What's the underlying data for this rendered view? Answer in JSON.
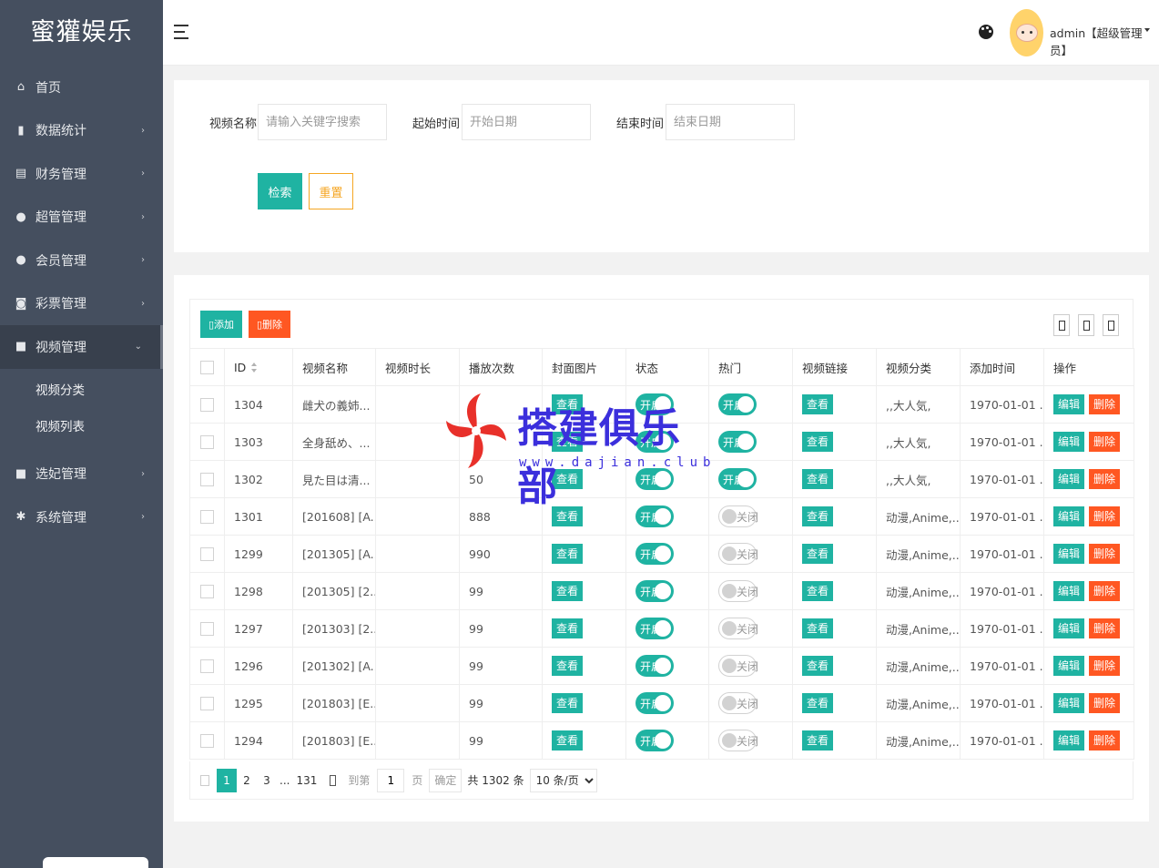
{
  "app": {
    "logo": "蜜獾娱乐"
  },
  "sidebar": {
    "items": [
      {
        "label": "首页",
        "icon": "home-icon",
        "has_arrow": false
      },
      {
        "label": "数据统计",
        "icon": "bar-chart-icon",
        "has_arrow": true
      },
      {
        "label": "财务管理",
        "icon": "bank-icon",
        "has_arrow": true
      },
      {
        "label": "超管管理",
        "icon": "user-icon",
        "has_arrow": true
      },
      {
        "label": "会员管理",
        "icon": "users-icon",
        "has_arrow": true
      },
      {
        "label": "彩票管理",
        "icon": "gamepad-icon",
        "has_arrow": true
      },
      {
        "label": "视频管理",
        "icon": "video-icon",
        "has_arrow": true,
        "active": true,
        "expanded": true
      },
      {
        "label": "选妃管理",
        "icon": "video-icon",
        "has_arrow": true
      },
      {
        "label": "系统管理",
        "icon": "gear-icon",
        "has_arrow": true
      }
    ],
    "sub_items": [
      "视频分类",
      "视频列表"
    ]
  },
  "header": {
    "user": "admin【超级管理员】"
  },
  "search": {
    "name_label": "视频名称",
    "name_placeholder": "请输入关键字搜索",
    "start_label": "起始时间",
    "start_placeholder": "开始日期",
    "end_label": "结束时间",
    "end_placeholder": "结束日期",
    "search_btn": "检索",
    "reset_btn": "重置"
  },
  "toolbar": {
    "add_label": "添加",
    "delete_label": "删除"
  },
  "table": {
    "headers": [
      "ID",
      "视频名称",
      "视频时长",
      "播放次数",
      "封面图片",
      "状态",
      "热门",
      "视频链接",
      "视频分类",
      "添加时间",
      "操作"
    ],
    "view_label": "查看",
    "on_label": "开启",
    "off_label": "关闭",
    "edit_label": "编辑",
    "delete_label": "删除",
    "rows": [
      {
        "id": "1304",
        "name": "雌犬の義姉...",
        "duration": "",
        "plays": "5",
        "status": "开启",
        "hot": "开启",
        "category": ",,大人気,",
        "added": "1970-01-01 ..."
      },
      {
        "id": "1303",
        "name": "全身舐め、...",
        "duration": "",
        "plays": "",
        "status": "开启",
        "hot": "开启",
        "category": ",,大人気,",
        "added": "1970-01-01 ..."
      },
      {
        "id": "1302",
        "name": "見た目は清...",
        "duration": "",
        "plays": "50",
        "status": "开启",
        "hot": "开启",
        "category": ",,大人気,",
        "added": "1970-01-01 ..."
      },
      {
        "id": "1301",
        "name": "[201608] [A...",
        "duration": "",
        "plays": "888",
        "status": "开启",
        "hot": "关闭",
        "category": "动漫,Anime,...",
        "added": "1970-01-01 ..."
      },
      {
        "id": "1299",
        "name": "[201305] [A...",
        "duration": "",
        "plays": "990",
        "status": "开启",
        "hot": "关闭",
        "category": "动漫,Anime,...",
        "added": "1970-01-01 ..."
      },
      {
        "id": "1298",
        "name": "[201305] [2...",
        "duration": "",
        "plays": "99",
        "status": "开启",
        "hot": "关闭",
        "category": "动漫,Anime,...",
        "added": "1970-01-01 ..."
      },
      {
        "id": "1297",
        "name": "[201303] [2...",
        "duration": "",
        "plays": "99",
        "status": "开启",
        "hot": "关闭",
        "category": "动漫,Anime,...",
        "added": "1970-01-01 ..."
      },
      {
        "id": "1296",
        "name": "[201302] [A...",
        "duration": "",
        "plays": "99",
        "status": "开启",
        "hot": "关闭",
        "category": "动漫,Anime,...",
        "added": "1970-01-01 ..."
      },
      {
        "id": "1295",
        "name": "[201803] [E...",
        "duration": "",
        "plays": "99",
        "status": "开启",
        "hot": "关闭",
        "category": "动漫,Anime,...",
        "added": "1970-01-01 ..."
      },
      {
        "id": "1294",
        "name": "[201803] [E...",
        "duration": "",
        "plays": "99",
        "status": "开启",
        "hot": "关闭",
        "category": "动漫,Anime,...",
        "added": "1970-01-01 ..."
      }
    ]
  },
  "pagination": {
    "pages": [
      "1",
      "2",
      "3"
    ],
    "current": "1",
    "ellipsis": "...",
    "last": "131",
    "goto_label": "到第",
    "goto_value": "1",
    "page_label": "页",
    "confirm_label": "确定",
    "total_label": "共 1302 条",
    "page_size": "10 条/页"
  },
  "watermark": {
    "title": "搭建俱乐部",
    "url": "www.dajian.club"
  },
  "colors": {
    "sidebar_bg": "#454f5f",
    "accent": "#1fb3a2",
    "danger": "#ff5722",
    "warning": "#f5a623"
  }
}
